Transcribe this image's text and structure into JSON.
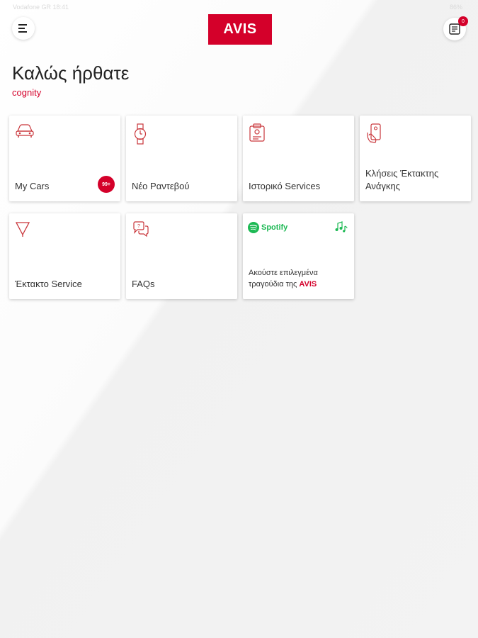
{
  "status_bar": {
    "left": "Vodafone GR  18:41",
    "right": "86%"
  },
  "header": {
    "logo_text": "AVIS",
    "notification_count": "0"
  },
  "welcome": {
    "title": "Καλώς ήρθατε",
    "user": "cognity"
  },
  "tiles": [
    {
      "label": "My Cars",
      "icon": "car-icon",
      "badge": "99+"
    },
    {
      "label": "Νέο Ραντεβού",
      "icon": "watch-icon"
    },
    {
      "label": "Ιστορικό Services",
      "icon": "clipboard-icon"
    },
    {
      "label": "Κλήσεις Έκτακτης Ανάγκης",
      "icon": "phone-hand-icon"
    },
    {
      "label": "Έκτακτο Service",
      "icon": "warning-triangle-icon"
    },
    {
      "label": "FAQs",
      "icon": "chat-bubbles-icon"
    }
  ],
  "spotify_tile": {
    "brand": "Spotify",
    "text": "Ακούστε επιλεγμένα τραγούδια της",
    "highlight": "AVIS",
    "icon": "music-notes-icon"
  },
  "colors": {
    "accent": "#d4002a",
    "spotify": "#1db954"
  }
}
